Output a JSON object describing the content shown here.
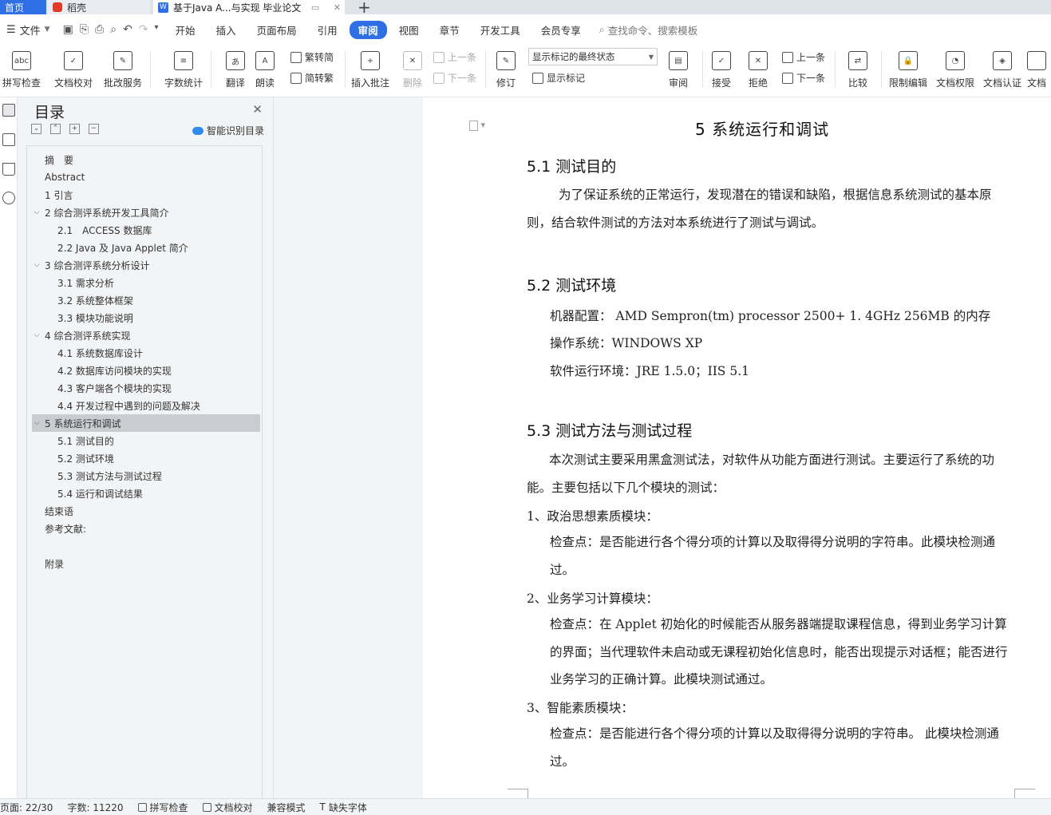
{
  "tabs": {
    "home": "首页",
    "wps": "稻壳",
    "doc": "基于Java A...与实现 毕业论文",
    "add": "+"
  },
  "menu": {
    "file": "文件",
    "tabs": [
      "开始",
      "插入",
      "页面布局",
      "引用",
      "审阅",
      "视图",
      "章节",
      "开发工具",
      "会员专享"
    ],
    "active_tab": "审阅",
    "search": "查找命令、搜索模板"
  },
  "ribbon": {
    "spell": "拼写检查",
    "proof": "文档校对",
    "review_service": "批改服务",
    "word_count": "字数统计",
    "translate": "翻译",
    "read": "朗读",
    "t2s": "繁转简",
    "s2t": "简转繁",
    "insert_comment": "插入批注",
    "delete": "删除",
    "prev": "上一条",
    "next": "下一条",
    "track": "修订",
    "display_select": "显示标记的最终状态",
    "show_marks": "显示标记",
    "review": "审阅",
    "accept": "接受",
    "reject": "拒绝",
    "prev2": "上一条",
    "next2": "下一条",
    "compare": "比较",
    "restrict": "限制编辑",
    "doc_perm": "文档权限",
    "doc_cert": "文档认证",
    "doc_more": "文档"
  },
  "nav": {
    "title": "目录",
    "smart": "智能识别目录",
    "items": [
      {
        "label": "摘　要",
        "level": 1,
        "caret": ""
      },
      {
        "label": "Abstract",
        "level": 1,
        "caret": ""
      },
      {
        "label": "1 引言",
        "level": 1,
        "caret": ""
      },
      {
        "label": "2 综合测评系统开发工具简介",
        "level": 1,
        "caret": "v"
      },
      {
        "label": "2.1　ACCESS 数据库",
        "level": 2,
        "caret": ""
      },
      {
        "label": "2.2 Java 及 Java Applet 简介",
        "level": 2,
        "caret": ""
      },
      {
        "label": "3 综合测评系统分析设计",
        "level": 1,
        "caret": "v"
      },
      {
        "label": "3.1 需求分析",
        "level": 2,
        "caret": ""
      },
      {
        "label": "3.2 系统整体框架",
        "level": 2,
        "caret": ""
      },
      {
        "label": "3.3 模块功能说明",
        "level": 2,
        "caret": ""
      },
      {
        "label": "4 综合测评系统实现",
        "level": 1,
        "caret": "v"
      },
      {
        "label": "4.1 系统数据库设计",
        "level": 2,
        "caret": ""
      },
      {
        "label": "4.2 数据库访问模块的实现",
        "level": 2,
        "caret": ""
      },
      {
        "label": "4.3 客户端各个模块的实现",
        "level": 2,
        "caret": ""
      },
      {
        "label": "4.4 开发过程中遇到的问题及解决",
        "level": 2,
        "caret": ""
      },
      {
        "label": "5 系统运行和调试",
        "level": 1,
        "caret": "v",
        "active": true
      },
      {
        "label": "5.1 测试目的",
        "level": 2,
        "caret": ""
      },
      {
        "label": "5.2 测试环境",
        "level": 2,
        "caret": ""
      },
      {
        "label": "5.3 测试方法与测试过程",
        "level": 2,
        "caret": ""
      },
      {
        "label": "5.4 运行和调试结果",
        "level": 2,
        "caret": ""
      },
      {
        "label": "结束语",
        "level": 1,
        "caret": ""
      },
      {
        "label": "参考文献:",
        "level": 1,
        "caret": ""
      },
      {
        "label": "附录",
        "level": 1,
        "caret": "",
        "gap": true
      }
    ]
  },
  "doc": {
    "chapter": "5  系统运行和调试",
    "s1": "5.1 测试目的",
    "p1": "为了保证系统的正常运行，发现潜在的错误和缺陷，根据信息系统测试的基本原则，结合软件测试的方法对本系统进行了测试与调试。",
    "s2": "5.2 测试环境",
    "env1": "机器配置：  AMD Sempron(tm) processor  2500+  1. 4GHz      256MB 的内存",
    "env2": "操作系统：WINDOWS XP",
    "env3": "软件运行环境：JRE 1.5.0；IIS 5.1",
    "s3": "5.3 测试方法与测试过程",
    "p3": "本次测试主要采用黑盒测试法，对软件从功能方面进行测试。主要运行了系统的功能。主要包括以下几个模块的测试：",
    "m1": "1、政治思想素质模块：",
    "m1c": "检查点：是否能进行各个得分项的计算以及取得得分说明的字符串。此模块检测通过。",
    "m2": "2、业务学习计算模块：",
    "m2c": "检查点：在 Applet 初始化的时候能否从服务器端提取课程信息，得到业务学习计算的界面；当代理软件未启动或无课程初始化信息时，能否出现提示对话框；能否进行业务学习的正确计算。此模块测试通过。",
    "m3": "3、智能素质模块：",
    "m3c": "检查点：是否能进行各个得分项的计算以及取得得分说明的字符串。 此模块检测通过。"
  },
  "status": {
    "page": "页面: 22/30",
    "words": "字数: 11220",
    "spell": "拼写检查",
    "proof": "文档校对",
    "compat": "兼容模式",
    "missing_font": "缺失字体"
  },
  "colors": {
    "accent": "#2f6fe6",
    "selected": "#c9ccd1"
  }
}
